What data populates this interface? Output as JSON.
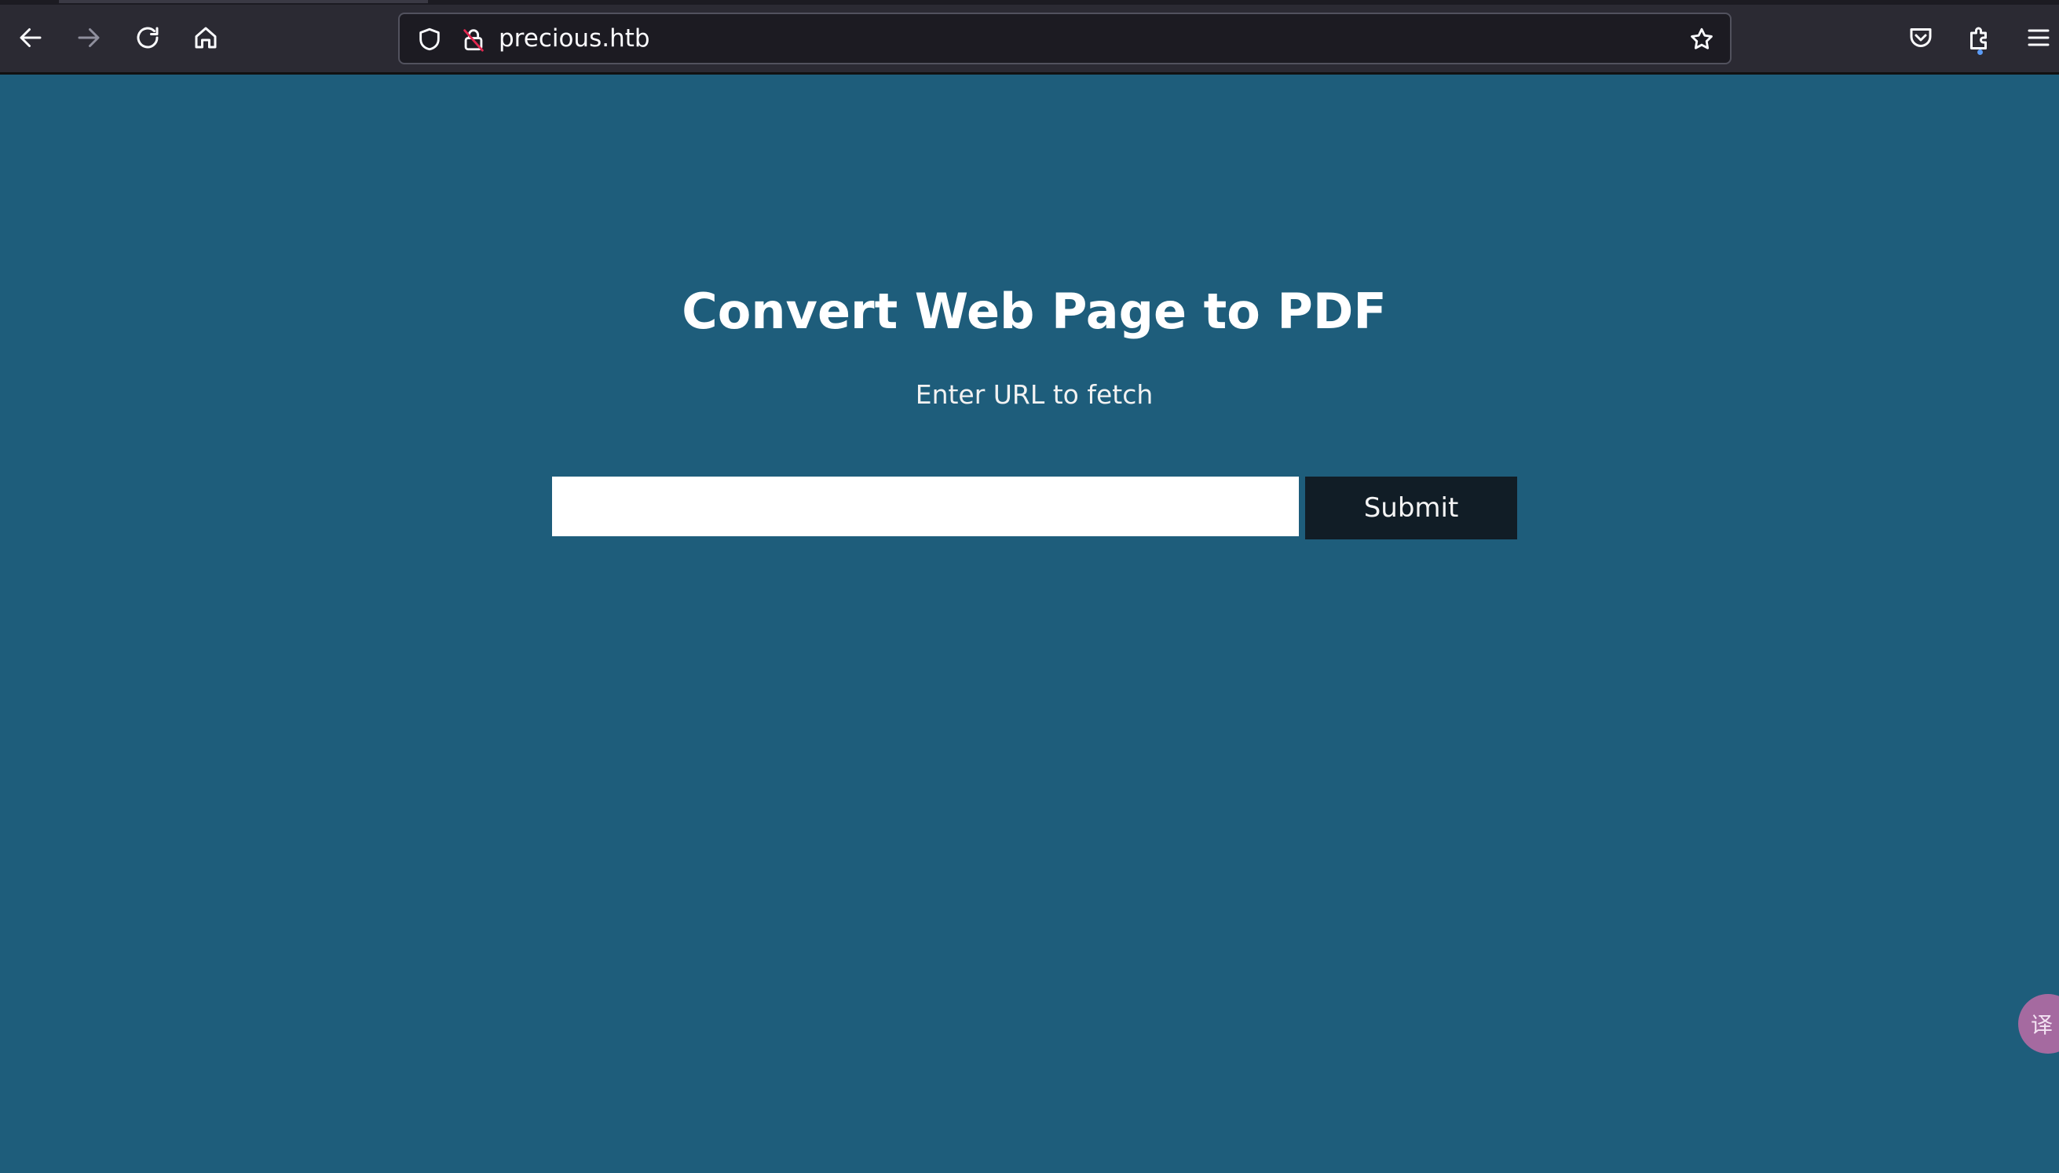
{
  "browser": {
    "url": "precious.htb",
    "icons": {
      "back": "arrow-left-icon",
      "forward": "arrow-right-icon",
      "reload": "reload-icon",
      "home": "home-icon",
      "tracking_protection": "shield-icon",
      "connection_insecure": "insecure-lock-icon",
      "bookmark": "star-icon",
      "pocket": "pocket-icon",
      "extensions": "puzzle-icon",
      "menu": "hamburger-menu-icon"
    }
  },
  "page": {
    "title": "Convert Web Page to PDF",
    "subtitle": "Enter URL to fetch",
    "url_input_value": "",
    "submit_label": "Submit",
    "translate_widget_glyph": "译"
  },
  "colors": {
    "page_background": "#1e5d7b",
    "submit_background": "#111d26",
    "toolbar_background": "#2b2a33",
    "insecure_accent": "#e22850",
    "translate_bubble": "#a56aa0"
  }
}
